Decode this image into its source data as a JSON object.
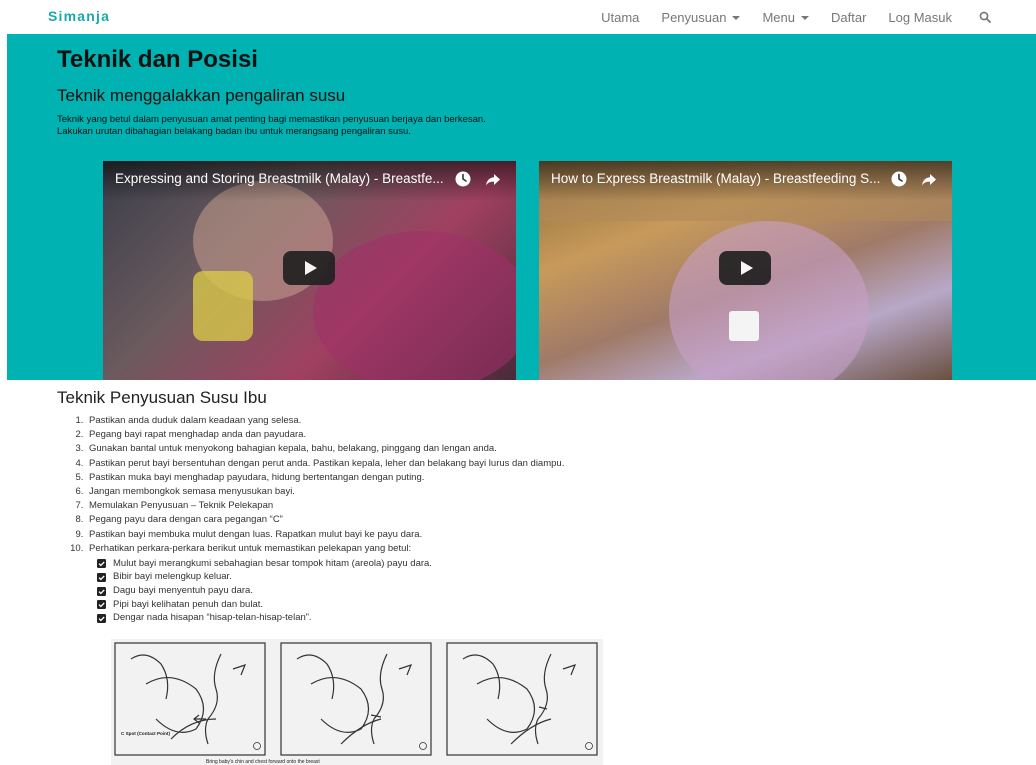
{
  "navbar": {
    "brand": "Simanja",
    "items": [
      {
        "label": "Utama"
      },
      {
        "label": "Penyusuan",
        "dropdown": true
      },
      {
        "label": "Menu",
        "dropdown": true
      },
      {
        "label": "Daftar"
      },
      {
        "label": "Log Masuk"
      }
    ],
    "search_icon": "search-icon"
  },
  "hero": {
    "title": "Teknik dan Posisi",
    "subtitle": "Teknik menggalakkan pengaliran susu",
    "text_line1": "Teknik yang betul dalam penyusuan amat penting bagi memastikan penyusuan berjaya dan berkesan.",
    "text_line2": "Lakukan urutan dibahagian belakang badan ibu untuk merangsang pengaliran susu.",
    "background_color": "#00b2b2",
    "videos": [
      {
        "title": "Expressing and Storing Breastmilk (Malay) - Breastfe..."
      },
      {
        "title": "How to Express Breastmilk (Malay) - Breastfeeding S..."
      }
    ]
  },
  "main": {
    "section_title": "Teknik Penyusuan Susu Ibu",
    "steps": [
      "Pastikan anda duduk dalam keadaan yang selesa.",
      "Pegang bayi rapat menghadap anda dan payudara.",
      "Gunakan bantal untuk menyokong bahagian kepala, bahu, belakang, pinggang dan lengan anda.",
      "Pastikan perut bayi bersentuhan dengan perut anda. Pastikan kepala, leher dan belakang bayi lurus dan diampu.",
      "Pastikan muka bayi menghadap payudara, hidung bertentangan dengan puting.",
      "Jangan membongkok semasa menyusukan bayi.",
      "Memulakan Penyusuan – Teknik Pelekapan",
      "Pegang payu dara dengan cara pegangan “C”",
      "Pastikan bayi membuka mulut dengan luas. Rapatkan mulut bayi ke payu dara.",
      "Perhatikan perkara-perkara berikut untuk memastikan pelekapan yang betul:"
    ],
    "checks": [
      "Mulut bayi merangkumi sebahagian besar tompok hitam (areola) payu dara.",
      "Bibir bayi melengkup keluar.",
      "Dagu bayi menyentuh payu dara.",
      "Pipi bayi kelihatan penuh dan bulat.",
      "Dengar nada hisapan “hisap-telan-hisap-telan”."
    ],
    "diagram": {
      "cspot_label": "C Spot (Contact Point)",
      "caption": "Bring baby's chin and chest forward onto the breast"
    }
  }
}
